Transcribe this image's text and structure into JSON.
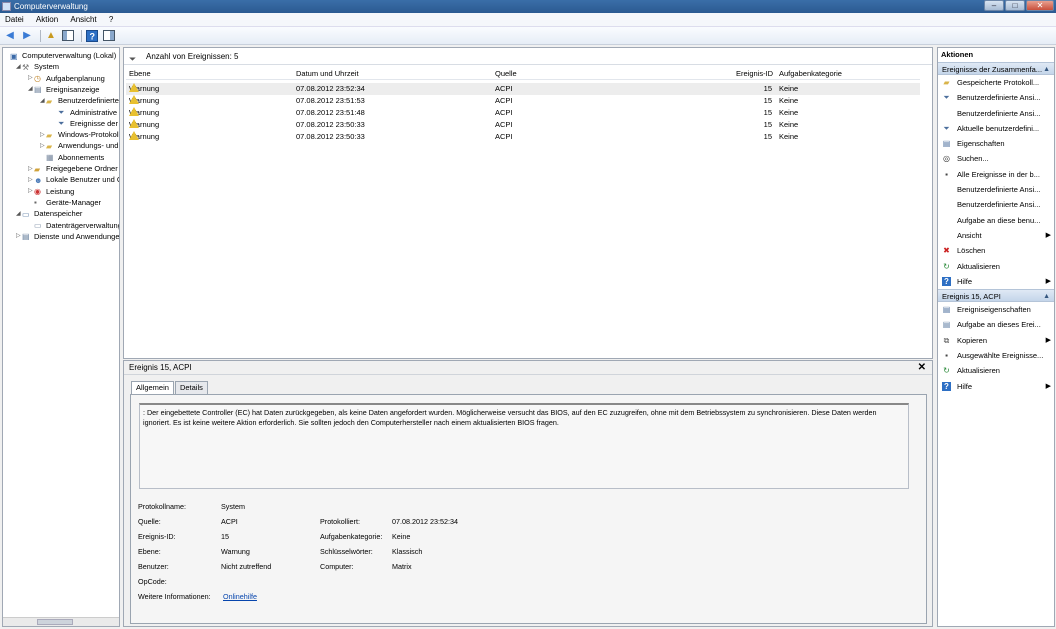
{
  "window": {
    "title": "Computerverwaltung"
  },
  "menu": [
    "Datei",
    "Aktion",
    "Ansicht",
    "?"
  ],
  "tree": [
    {
      "label": "Computerverwaltung (Lokal)",
      "level": 0,
      "icon": "computer-icon",
      "expander": ""
    },
    {
      "label": "System",
      "level": 1,
      "icon": "tools-icon",
      "expander": "◢"
    },
    {
      "label": "Aufgabenplanung",
      "level": 2,
      "icon": "clock-icon",
      "expander": "▷"
    },
    {
      "label": "Ereignisanzeige",
      "level": 2,
      "icon": "event-viewer-icon",
      "expander": "◢"
    },
    {
      "label": "Benutzerdefinierte A",
      "level": 3,
      "icon": "folder-icon",
      "expander": "◢"
    },
    {
      "label": "Administrative E",
      "level": 4,
      "icon": "filter-icon",
      "expander": ""
    },
    {
      "label": "Ereignisse der Zu",
      "level": 4,
      "icon": "filter-icon",
      "expander": ""
    },
    {
      "label": "Windows-Protokolle",
      "level": 3,
      "icon": "folder-icon",
      "expander": "▷"
    },
    {
      "label": "Anwendungs- und D",
      "level": 3,
      "icon": "folder-icon",
      "expander": "▷"
    },
    {
      "label": "Abonnements",
      "level": 3,
      "icon": "subscription-icon",
      "expander": ""
    },
    {
      "label": "Freigegebene Ordner",
      "level": 2,
      "icon": "shared-folder-icon",
      "expander": "▷"
    },
    {
      "label": "Lokale Benutzer und Gr",
      "level": 2,
      "icon": "users-icon",
      "expander": "▷"
    },
    {
      "label": "Leistung",
      "level": 2,
      "icon": "performance-icon",
      "expander": "▷"
    },
    {
      "label": "Geräte-Manager",
      "level": 2,
      "icon": "device-manager-icon",
      "expander": ""
    },
    {
      "label": "Datenspeicher",
      "level": 1,
      "icon": "storage-icon",
      "expander": "◢"
    },
    {
      "label": "Datenträgerverwaltung",
      "level": 2,
      "icon": "disk-icon",
      "expander": ""
    },
    {
      "label": "Dienste und Anwendungen",
      "level": 1,
      "icon": "services-icon",
      "expander": "▷"
    }
  ],
  "events": {
    "count_label": "Anzahl von Ereignissen: 5",
    "columns": {
      "level": "Ebene",
      "datetime": "Datum und Uhrzeit",
      "source": "Quelle",
      "id": "Ereignis-ID",
      "category": "Aufgabenkategorie"
    },
    "rows": [
      {
        "level": "Warnung",
        "datetime": "07.08.2012 23:52:34",
        "source": "ACPI",
        "id": "15",
        "category": "Keine"
      },
      {
        "level": "Warnung",
        "datetime": "07.08.2012 23:51:53",
        "source": "ACPI",
        "id": "15",
        "category": "Keine"
      },
      {
        "level": "Warnung",
        "datetime": "07.08.2012 23:51:48",
        "source": "ACPI",
        "id": "15",
        "category": "Keine"
      },
      {
        "level": "Warnung",
        "datetime": "07.08.2012 23:50:33",
        "source": "ACPI",
        "id": "15",
        "category": "Keine"
      },
      {
        "level": "Warnung",
        "datetime": "07.08.2012 23:50:33",
        "source": "ACPI",
        "id": "15",
        "category": "Keine"
      }
    ]
  },
  "detail": {
    "title": "Ereignis 15, ACPI",
    "close": "✕",
    "tabs": [
      "Allgemein",
      "Details"
    ],
    "description": ": Der eingebettete Controller (EC) hat Daten zurückgegeben, als keine Daten angefordert wurden. Möglicherweise versucht das BIOS, auf den EC zuzugreifen, ohne mit dem Betriebssystem zu synchronisieren. Diese Daten werden ignoriert. Es ist keine weitere Aktion erforderlich. Sie sollten jedoch den Computerhersteller nach einem aktualisierten BIOS fragen.",
    "props": {
      "log_label": "Protokollname:",
      "log_value": "System",
      "source_label": "Quelle:",
      "source_value": "ACPI",
      "logged_label": "Protokolliert:",
      "logged_value": "07.08.2012 23:52:34",
      "id_label": "Ereignis-ID:",
      "id_value": "15",
      "category_label": "Aufgabenkategorie:",
      "category_value": "Keine",
      "level_label": "Ebene:",
      "level_value": "Warnung",
      "keywords_label": "Schlüsselwörter:",
      "keywords_value": "Klassisch",
      "user_label": "Benutzer:",
      "user_value": "Nicht zutreffend",
      "computer_label": "Computer:",
      "computer_value": "Matrix",
      "opcode_label": "OpCode:",
      "more_label": "Weitere Informationen:",
      "more_link": "Onlinehilfe"
    }
  },
  "actions": {
    "title": "Aktionen",
    "section1": "Ereignisse der Zusammenfa...",
    "items1": [
      {
        "label": "Gespeicherte Protokoll...",
        "icon": "open-folder-icon",
        "submenu": false
      },
      {
        "label": "Benutzerdefinierte Ansi...",
        "icon": "filter-icon",
        "submenu": false
      },
      {
        "label": "Benutzerdefinierte Ansi...",
        "icon": "",
        "submenu": false
      },
      {
        "label": "Aktuelle benutzerdefini...",
        "icon": "filter-icon",
        "submenu": false
      },
      {
        "label": "Eigenschaften",
        "icon": "properties-icon",
        "submenu": false
      },
      {
        "label": "Suchen...",
        "icon": "binoculars-icon",
        "submenu": false
      },
      {
        "label": "Alle Ereignisse in der b...",
        "icon": "save-icon",
        "submenu": false
      },
      {
        "label": "Benutzerdefinierte Ansi...",
        "icon": "",
        "submenu": false
      },
      {
        "label": "Benutzerdefinierte Ansi...",
        "icon": "",
        "submenu": false
      },
      {
        "label": "Aufgabe an diese benu...",
        "icon": "",
        "submenu": false
      },
      {
        "label": "Ansicht",
        "icon": "",
        "submenu": true
      },
      {
        "label": "Löschen",
        "icon": "delete-icon",
        "submenu": false
      },
      {
        "label": "Aktualisieren",
        "icon": "refresh-icon",
        "submenu": false
      },
      {
        "label": "Hilfe",
        "icon": "help-icon",
        "submenu": true
      }
    ],
    "section2": "Ereignis 15, ACPI",
    "items2": [
      {
        "label": "Ereigniseigenschaften",
        "icon": "properties-icon",
        "submenu": false
      },
      {
        "label": "Aufgabe an dieses Erei...",
        "icon": "task-icon",
        "submenu": false
      },
      {
        "label": "Kopieren",
        "icon": "copy-icon",
        "submenu": true
      },
      {
        "label": "Ausgewählte Ereignisse...",
        "icon": "save-icon",
        "submenu": false
      },
      {
        "label": "Aktualisieren",
        "icon": "refresh-icon",
        "submenu": false
      },
      {
        "label": "Hilfe",
        "icon": "help-icon",
        "submenu": true
      }
    ]
  }
}
